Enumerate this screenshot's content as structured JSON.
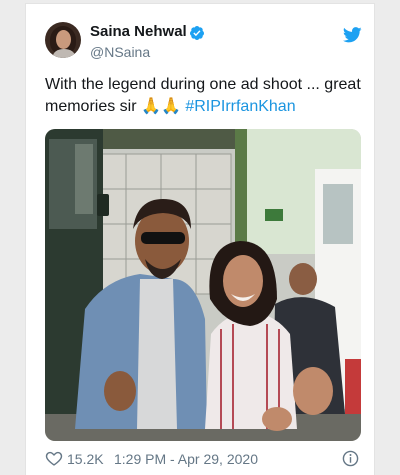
{
  "tweet": {
    "author_name": "Saina Nehwal",
    "author_handle": "@NSaina",
    "text_main": "With the legend during one ad shoot ... great memories sir",
    "text_emoji": "🙏🙏",
    "hashtag": "#RIPIrrfanKhan",
    "likes": "15.2K",
    "timestamp": "1:29 PM - Apr 29, 2020"
  },
  "colors": {
    "accent": "#1da1f2",
    "link": "#1b95e0",
    "text": "#14171a",
    "muted": "#657786"
  },
  "icons": [
    "verified-badge-icon",
    "twitter-bird-icon",
    "heart-icon",
    "info-icon"
  ]
}
